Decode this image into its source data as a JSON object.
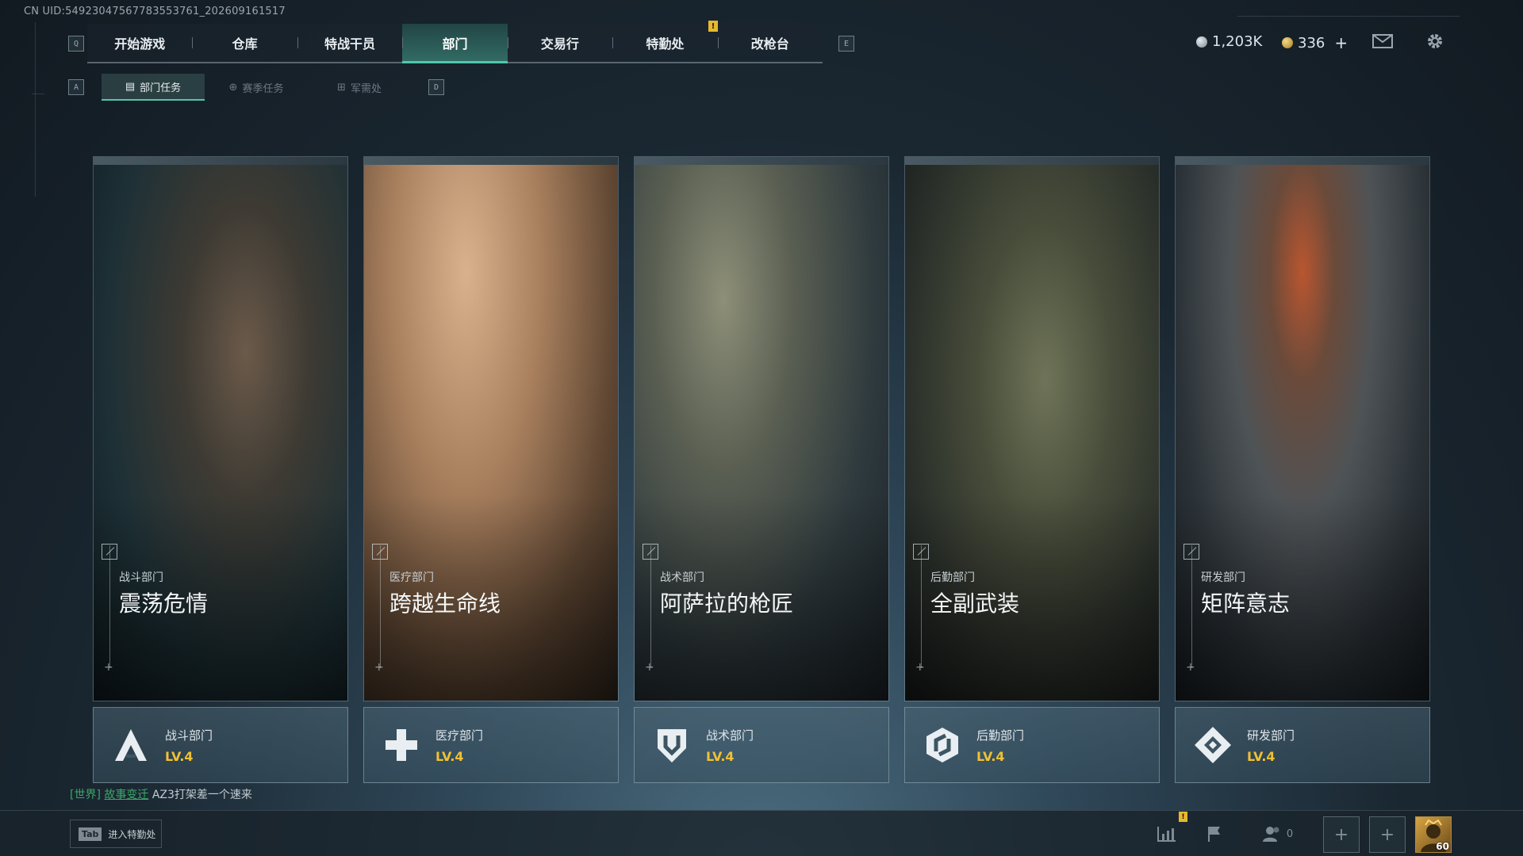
{
  "header": {
    "uid_text": "CN UID:5492304756778355376​1_202609161517",
    "nav_left_key": "Q",
    "nav_right_key": "E",
    "tabs": [
      {
        "label": "开始游戏",
        "active": false
      },
      {
        "label": "仓库",
        "active": false
      },
      {
        "label": "特战干员",
        "active": false
      },
      {
        "label": "部门",
        "active": true
      },
      {
        "label": "交易行",
        "active": false
      },
      {
        "label": "特勤处",
        "active": false
      },
      {
        "label": "改枪台",
        "active": false
      }
    ],
    "alert_mark": "!",
    "currency_silver": "1,203K",
    "currency_gold": "336",
    "currency_add": "+",
    "colors": {
      "accent": "#50c7ac",
      "level": "#f0c133",
      "alert": "#e6b92e"
    }
  },
  "subnav": {
    "left_key": "A",
    "right_key": "D",
    "tabs": [
      {
        "label": "部门任务",
        "active": true
      },
      {
        "label": "赛季任务",
        "active": false
      },
      {
        "label": "军需处",
        "active": false
      }
    ]
  },
  "departments": [
    {
      "dept": "战斗部门",
      "title": "震荡危情",
      "level": "LV.4",
      "icon": "combat-a-icon"
    },
    {
      "dept": "医疗部门",
      "title": "跨越生命线",
      "level": "LV.4",
      "icon": "medical-cross-icon"
    },
    {
      "dept": "战术部门",
      "title": "阿萨拉的枪匠",
      "level": "LV.4",
      "icon": "tactical-shield-icon"
    },
    {
      "dept": "后勤部门",
      "title": "全副武装",
      "level": "LV.4",
      "icon": "logistics-hex-icon"
    },
    {
      "dept": "研发部门",
      "title": "矩阵意志",
      "level": "LV.4",
      "icon": "research-diamond-icon"
    }
  ],
  "chat": {
    "channel": "[世界]",
    "sender": "故事变迁",
    "message": "AZ3打架差一个速来"
  },
  "footer": {
    "tab_key": "Tab",
    "tab_label": "进入特勤处",
    "friends_count": "0",
    "avatar_level": "60",
    "alert_mark": "!"
  }
}
